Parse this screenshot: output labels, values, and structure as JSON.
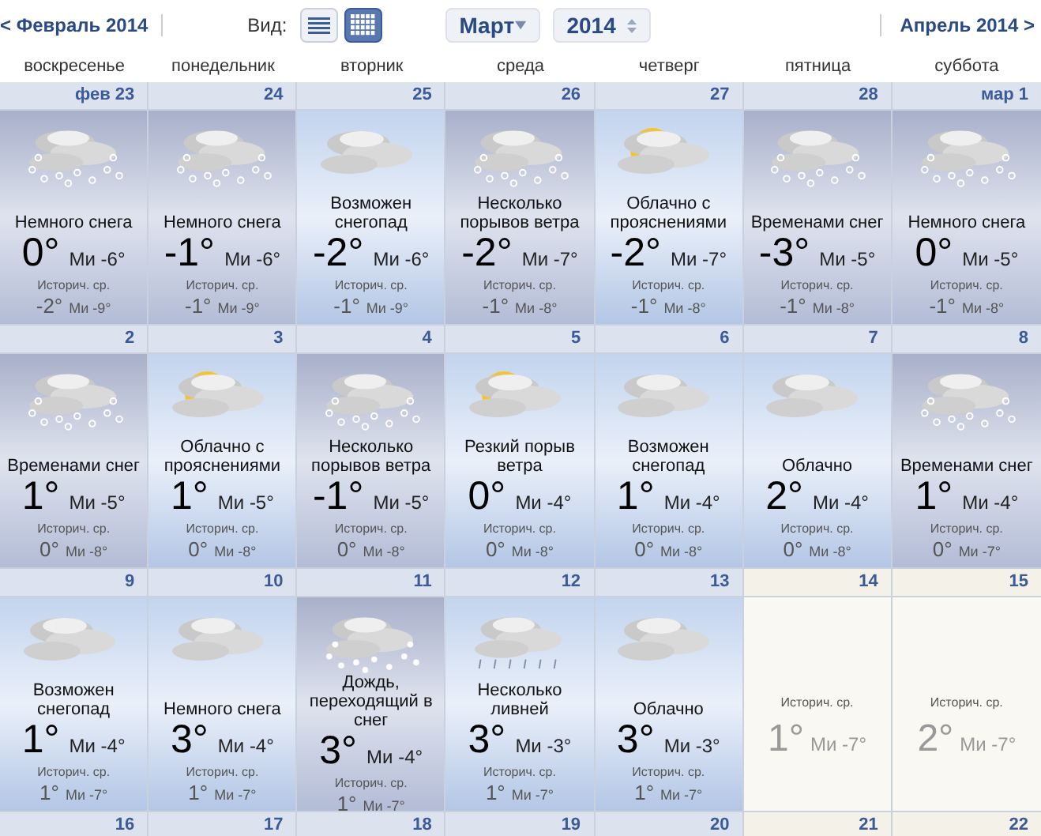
{
  "nav": {
    "prev": "< Февраль 2014",
    "view_label": "Вид:",
    "views": [
      {
        "kind": "list",
        "selected": false
      },
      {
        "kind": "grid",
        "selected": true
      }
    ],
    "month": "Март",
    "year": "2014",
    "next": "Апрель 2014 >"
  },
  "weekdays": [
    "воскресенье",
    "понедельник",
    "вторник",
    "среда",
    "четверг",
    "пятница",
    "суббота"
  ],
  "weeks": [
    {
      "days": [
        {
          "date": "фев 23",
          "kind": "snow",
          "condition": "Немного снега",
          "high": "0°",
          "low": "Ми -6°",
          "hist_label": "Историч. ср.",
          "hist_high": "-2°",
          "hist_low": "Ми -9°"
        },
        {
          "date": "24",
          "kind": "snow",
          "condition": "Немного снега",
          "high": "-1°",
          "low": "Ми -6°",
          "hist_label": "Историч. ср.",
          "hist_high": "-1°",
          "hist_low": "Ми -9°"
        },
        {
          "date": "25",
          "kind": "cloud",
          "condition": "Возможен снегопад",
          "high": "-2°",
          "low": "Ми -6°",
          "hist_label": "Историч. ср.",
          "hist_high": "-1°",
          "hist_low": "Ми -9°"
        },
        {
          "date": "26",
          "kind": "snow",
          "condition": "Несколько порывов ветра",
          "high": "-2°",
          "low": "Ми -7°",
          "hist_label": "Историч. ср.",
          "hist_high": "-1°",
          "hist_low": "Ми -8°"
        },
        {
          "date": "27",
          "kind": "sun-cloud",
          "condition": "Облачно с прояснениями",
          "high": "-2°",
          "low": "Ми -7°",
          "hist_label": "Историч. ср.",
          "hist_high": "-1°",
          "hist_low": "Ми -8°"
        },
        {
          "date": "28",
          "kind": "snow",
          "condition": "Временами снег",
          "high": "-3°",
          "low": "Ми -5°",
          "hist_label": "Историч. ср.",
          "hist_high": "-1°",
          "hist_low": "Ми -8°"
        },
        {
          "date": "мар 1",
          "kind": "snow",
          "condition": "Немного снега",
          "high": "0°",
          "low": "Ми -5°",
          "hist_label": "Историч. ср.",
          "hist_high": "-1°",
          "hist_low": "Ми -8°"
        }
      ]
    },
    {
      "days": [
        {
          "date": "2",
          "kind": "snow",
          "condition": "Временами снег",
          "high": "1°",
          "low": "Ми -5°",
          "hist_label": "Историч. ср.",
          "hist_high": "0°",
          "hist_low": "Ми -8°"
        },
        {
          "date": "3",
          "kind": "sun-cloud",
          "condition": "Облачно с прояснениями",
          "high": "1°",
          "low": "Ми -5°",
          "hist_label": "Историч. ср.",
          "hist_high": "0°",
          "hist_low": "Ми -8°"
        },
        {
          "date": "4",
          "kind": "snow",
          "condition": "Несколько порывов ветра",
          "high": "-1°",
          "low": "Ми -5°",
          "hist_label": "Историч. ср.",
          "hist_high": "0°",
          "hist_low": "Ми -8°"
        },
        {
          "date": "5",
          "kind": "sun-cloud",
          "condition": "Резкий порыв ветра",
          "high": "0°",
          "low": "Ми -4°",
          "hist_label": "Историч. ср.",
          "hist_high": "0°",
          "hist_low": "Ми -8°"
        },
        {
          "date": "6",
          "kind": "cloud",
          "condition": "Возможен снегопад",
          "high": "1°",
          "low": "Ми -4°",
          "hist_label": "Историч. ср.",
          "hist_high": "0°",
          "hist_low": "Ми -8°"
        },
        {
          "date": "7",
          "kind": "cloud",
          "condition": "Облачно",
          "high": "2°",
          "low": "Ми -4°",
          "hist_label": "Историч. ср.",
          "hist_high": "0°",
          "hist_low": "Ми -8°"
        },
        {
          "date": "8",
          "kind": "snow",
          "condition": "Временами снег",
          "high": "1°",
          "low": "Ми -4°",
          "hist_label": "Историч. ср.",
          "hist_high": "0°",
          "hist_low": "Ми -7°"
        }
      ]
    },
    {
      "days": [
        {
          "date": "9",
          "kind": "cloud",
          "condition": "Возможен снегопад",
          "high": "1°",
          "low": "Ми -4°",
          "hist_label": "Историч. ср.",
          "hist_high": "1°",
          "hist_low": "Ми -7°"
        },
        {
          "date": "10",
          "kind": "cloud",
          "condition": "Немного снега",
          "high": "3°",
          "low": "Ми -4°",
          "hist_label": "Историч. ср.",
          "hist_high": "1°",
          "hist_low": "Ми -7°"
        },
        {
          "date": "11",
          "kind": "sleet",
          "condition": "Дождь, переходящий в снег",
          "high": "3°",
          "low": "Ми -4°",
          "hist_label": "Историч. ср.",
          "hist_high": "1°",
          "hist_low": "Ми -7°"
        },
        {
          "date": "12",
          "kind": "rain",
          "condition": "Несколько ливней",
          "high": "3°",
          "low": "Ми -3°",
          "hist_label": "Историч. ср.",
          "hist_high": "1°",
          "hist_low": "Ми -7°"
        },
        {
          "date": "13",
          "kind": "cloud",
          "condition": "Облачно",
          "high": "3°",
          "low": "Ми -3°",
          "hist_label": "Историч. ср.",
          "hist_high": "1°",
          "hist_low": "Ми -7°"
        },
        {
          "date": "14",
          "kind": "history",
          "hist_label": "Историч. ср.",
          "hist_high": "1°",
          "hist_low": "Ми -7°"
        },
        {
          "date": "15",
          "kind": "history",
          "hist_label": "Историч. ср.",
          "hist_high": "2°",
          "hist_low": "Ми -7°"
        }
      ]
    },
    {
      "days": [
        {
          "date": "16",
          "kind": "future"
        },
        {
          "date": "17",
          "kind": "future"
        },
        {
          "date": "18",
          "kind": "future"
        },
        {
          "date": "19",
          "kind": "future"
        },
        {
          "date": "20",
          "kind": "future"
        },
        {
          "date": "21",
          "kind": "history"
        },
        {
          "date": "22",
          "kind": "history"
        }
      ]
    }
  ]
}
